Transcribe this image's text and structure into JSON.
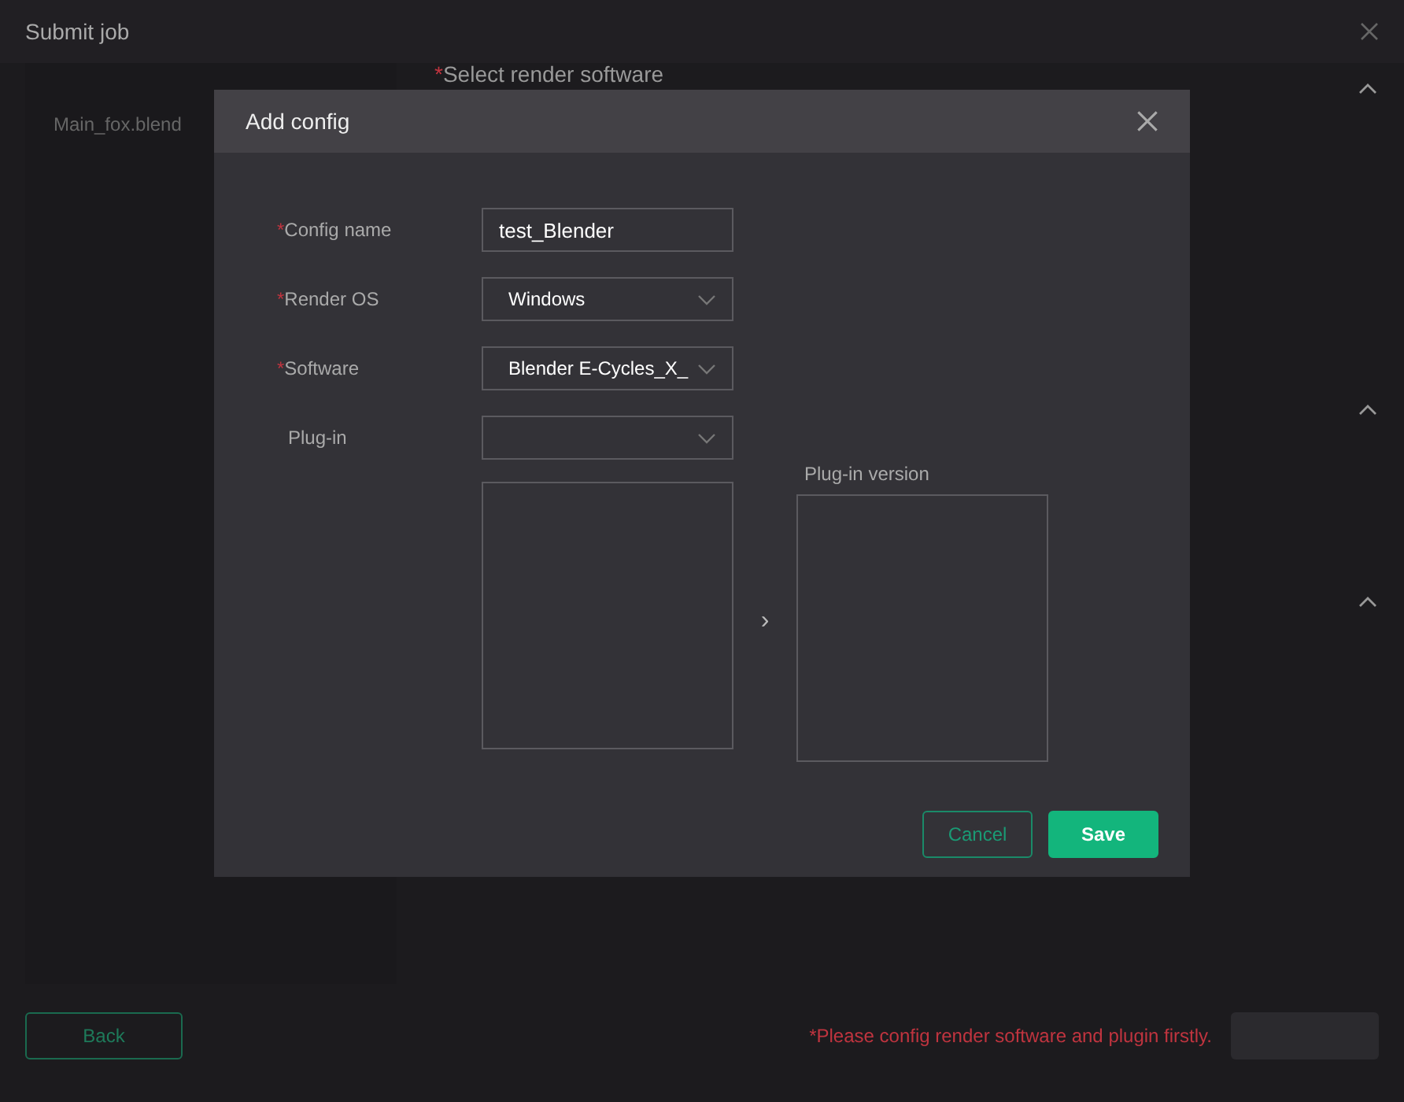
{
  "window": {
    "title": "Submit job"
  },
  "files": [
    {
      "name": "Main_fox.blend"
    }
  ],
  "section": {
    "mark": "*",
    "label": "Select render software"
  },
  "section_toggles": [
    {
      "expanded": true
    },
    {
      "expanded": true
    },
    {
      "expanded": true
    }
  ],
  "dialog": {
    "title": "Add config",
    "fields": [
      {
        "kind": "text",
        "mark": "*",
        "label": "Config name",
        "value": "test_Blender"
      },
      {
        "kind": "select",
        "mark": "*",
        "label": "Render OS",
        "value": "Windows"
      },
      {
        "kind": "select",
        "mark": "*",
        "label": "Software",
        "value": "Blender E-Cycles_X_"
      },
      {
        "kind": "select",
        "label": "Plug-in"
      }
    ],
    "transfer": {
      "right_title": "Plug-in version",
      "arrow": "›"
    },
    "buttons": [
      {
        "kind": "outline",
        "label": "Cancel"
      },
      {
        "kind": "primary",
        "label": "Save"
      }
    ]
  },
  "footer": {
    "back": "Back",
    "message": "*Please config render software and plugin firstly.",
    "submit_disabled": true
  }
}
